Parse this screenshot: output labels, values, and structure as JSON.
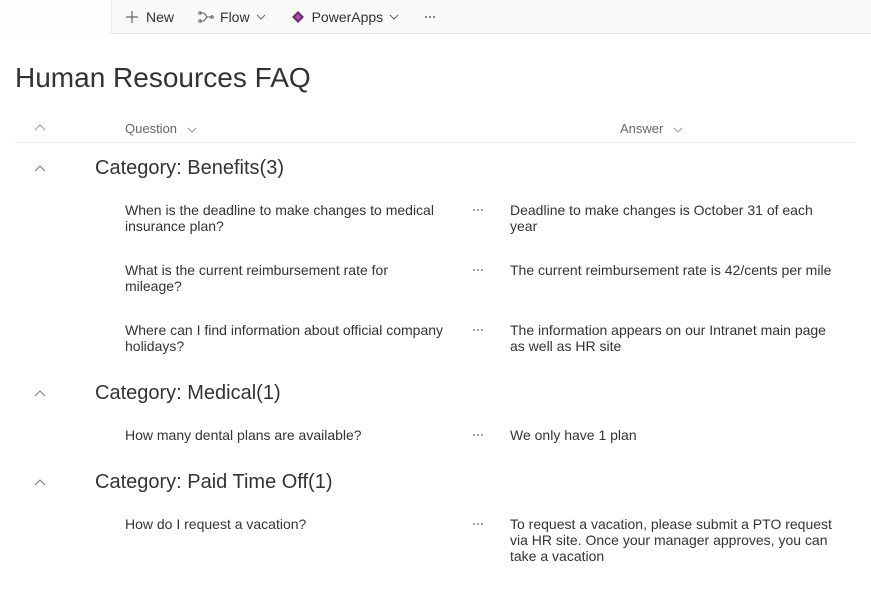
{
  "commandBar": {
    "new": "New",
    "flow": "Flow",
    "powerApps": "PowerApps"
  },
  "page": {
    "title": "Human Resources FAQ"
  },
  "columns": {
    "question": "Question",
    "answer": "Answer"
  },
  "groups": [
    {
      "label": "Category: Benefits(3)",
      "items": [
        {
          "question": "When is the deadline to make changes to medical insurance plan?",
          "answer": "Deadline to make changes is October 31 of each year"
        },
        {
          "question": "What is the current reimbursement rate for mileage?",
          "answer": "The current reimbursement rate is 42/cents per mile"
        },
        {
          "question": "Where can I find information about official company holidays?",
          "answer": "The information appears on our Intranet main page as well as HR site"
        }
      ]
    },
    {
      "label": "Category: Medical(1)",
      "items": [
        {
          "question": "How many dental plans are available?",
          "answer": "We only have 1 plan"
        }
      ]
    },
    {
      "label": "Category: Paid Time Off(1)",
      "items": [
        {
          "question": "How do I request a vacation?",
          "answer": "To request a vacation, please submit a PTO request via HR site. Once your manager approves, you can take a vacation"
        }
      ]
    }
  ]
}
